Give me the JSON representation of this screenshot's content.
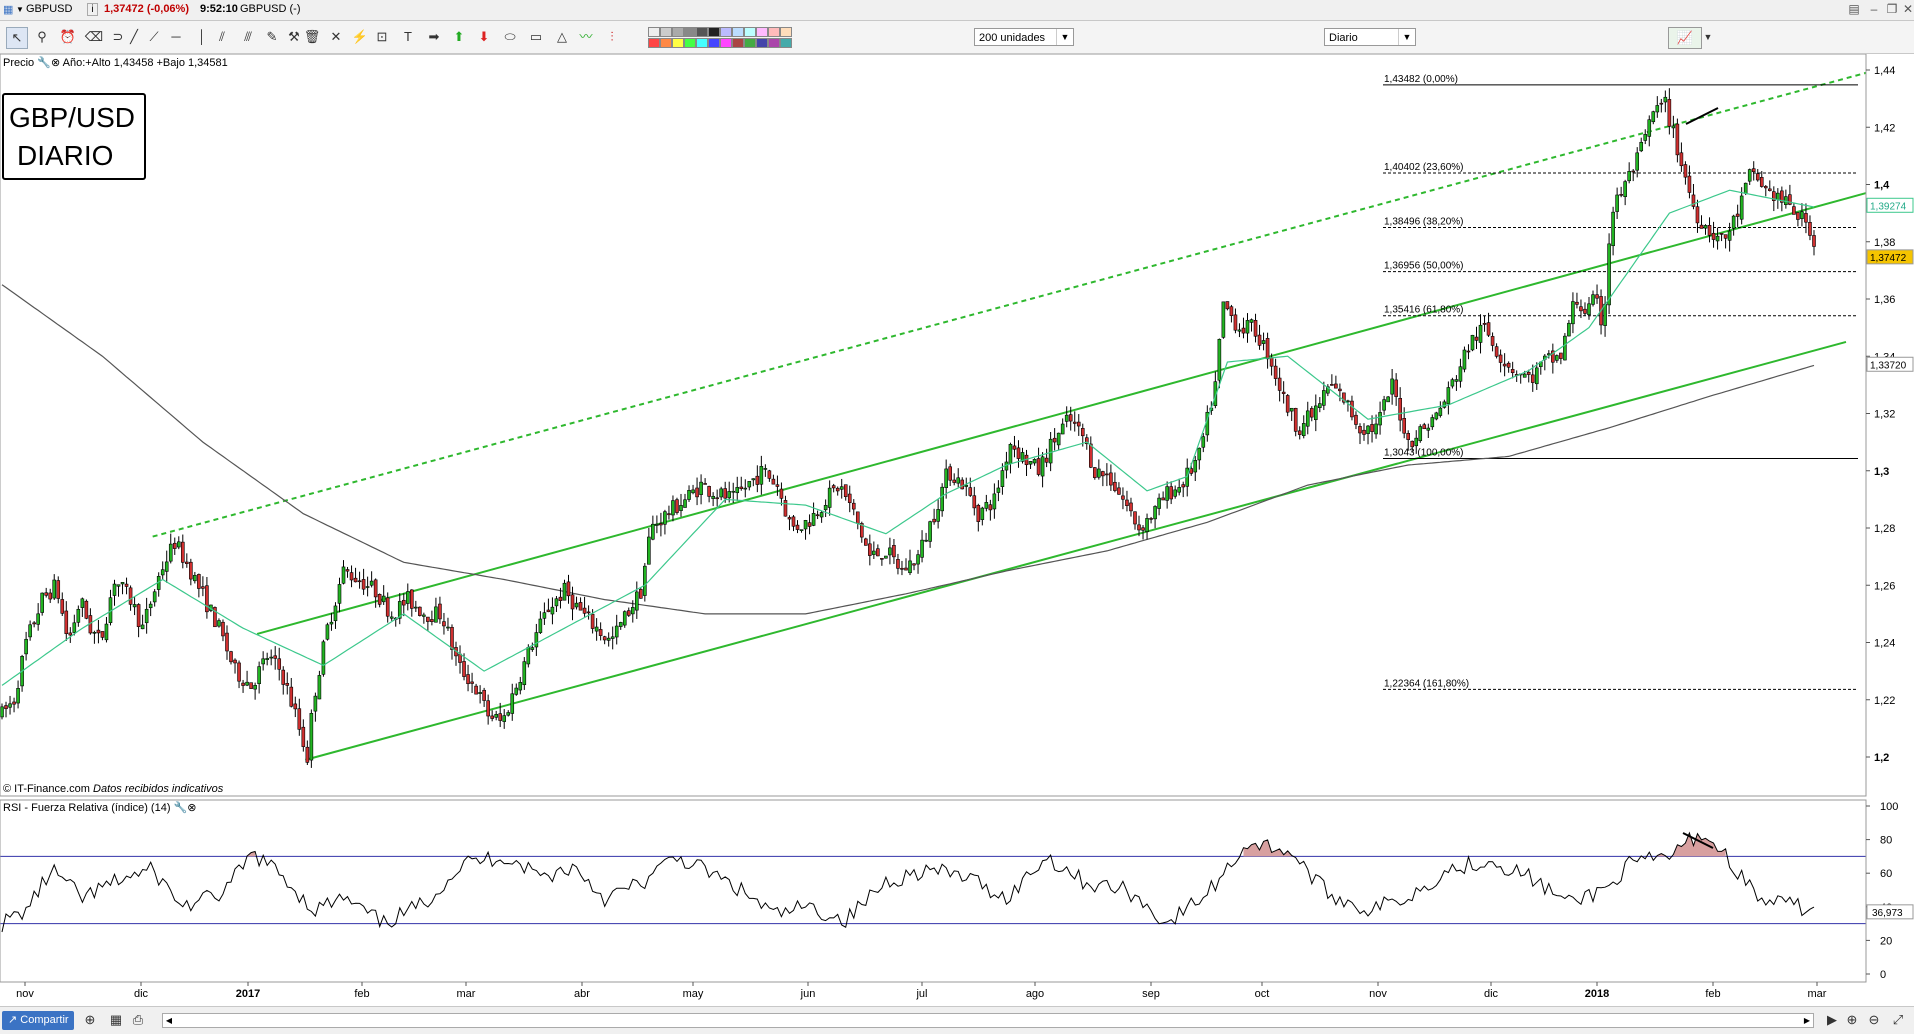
{
  "header": {
    "symbol": "GBPUSD",
    "price_info": "1,37472 (-0,06%)",
    "time_info": "9:52:10",
    "symbol_state": "GBPUSD (-)"
  },
  "toolbar": {
    "units_select": "200 unidades",
    "period_select": "Diario"
  },
  "legend": {
    "price_label": "Precio",
    "year_info": "Año:+Alto 1,43458 +Bajo 1,34581",
    "box_line1": "GBP/USD",
    "box_line2": "DIARIO",
    "source": "© IT-Finance.com",
    "source_note": "Datos recibidos indicativos",
    "rsi_label": "RSI - Fuerza Relativa (índice) (14)"
  },
  "footer": {
    "share_label": "Compartir"
  },
  "colors": {
    "up_candle": "#22b422",
    "down_candle": "#d03030",
    "channel": "#2eb82e",
    "sma_short": "#3cc88c",
    "sma_long": "#555555",
    "rsi_band": "#3333aa",
    "price_tag": "#f5c400"
  },
  "chart_data": [
    {
      "type": "candlestick",
      "title": "GBP/USD DIARIO",
      "x_ticks": [
        "nov",
        "dic",
        "2017",
        "feb",
        "mar",
        "abr",
        "may",
        "jun",
        "jul",
        "ago",
        "sep",
        "oct",
        "nov",
        "dic",
        "2018",
        "feb",
        "mar"
      ],
      "y_ticks": [
        "1,44",
        "1,42",
        "1,4",
        "1,38",
        "1,36",
        "1,34",
        "1,32",
        "1,3",
        "1,28",
        "1,26",
        "1,24",
        "1,22",
        "1,2"
      ],
      "ylim": [
        1.19,
        1.445
      ],
      "anchors": [
        [
          0,
          1.215
        ],
        [
          6,
          1.22
        ],
        [
          12,
          1.24
        ],
        [
          20,
          1.255
        ],
        [
          27,
          1.26
        ],
        [
          33,
          1.24
        ],
        [
          39,
          1.255
        ],
        [
          44,
          1.245
        ],
        [
          49,
          1.24
        ],
        [
          56,
          1.262
        ],
        [
          64,
          1.255
        ],
        [
          70,
          1.245
        ],
        [
          79,
          1.265
        ],
        [
          86,
          1.275
        ],
        [
          94,
          1.265
        ],
        [
          101,
          1.255
        ],
        [
          108,
          1.245
        ],
        [
          116,
          1.23
        ],
        [
          124,
          1.225
        ],
        [
          132,
          1.235
        ],
        [
          139,
          1.23
        ],
        [
          146,
          1.215
        ],
        [
          152,
          1.2
        ],
        [
          155,
          1.22
        ],
        [
          162,
          1.245
        ],
        [
          170,
          1.265
        ],
        [
          178,
          1.262
        ],
        [
          186,
          1.258
        ],
        [
          194,
          1.25
        ],
        [
          202,
          1.255
        ],
        [
          211,
          1.25
        ],
        [
          219,
          1.25
        ],
        [
          227,
          1.232
        ],
        [
          235,
          1.225
        ],
        [
          242,
          1.215
        ],
        [
          249,
          1.212
        ],
        [
          256,
          1.225
        ],
        [
          264,
          1.24
        ],
        [
          272,
          1.252
        ],
        [
          280,
          1.258
        ],
        [
          289,
          1.25
        ],
        [
          296,
          1.245
        ],
        [
          303,
          1.24
        ],
        [
          311,
          1.25
        ],
        [
          318,
          1.258
        ],
        [
          323,
          1.28
        ],
        [
          331,
          1.285
        ],
        [
          340,
          1.29
        ],
        [
          348,
          1.295
        ],
        [
          356,
          1.292
        ],
        [
          364,
          1.29
        ],
        [
          371,
          1.295
        ],
        [
          379,
          1.3
        ],
        [
          386,
          1.295
        ],
        [
          393,
          1.28
        ],
        [
          401,
          1.282
        ],
        [
          410,
          1.29
        ],
        [
          417,
          1.295
        ],
        [
          424,
          1.285
        ],
        [
          432,
          1.27
        ],
        [
          440,
          1.272
        ],
        [
          448,
          1.265
        ],
        [
          456,
          1.27
        ],
        [
          464,
          1.285
        ],
        [
          471,
          1.3
        ],
        [
          479,
          1.295
        ],
        [
          486,
          1.285
        ],
        [
          494,
          1.29
        ],
        [
          502,
          1.31
        ],
        [
          508,
          1.305
        ],
        [
          516,
          1.3
        ],
        [
          523,
          1.31
        ],
        [
          531,
          1.318
        ],
        [
          538,
          1.312
        ],
        [
          544,
          1.3
        ],
        [
          551,
          1.298
        ],
        [
          558,
          1.29
        ],
        [
          566,
          1.28
        ],
        [
          573,
          1.285
        ],
        [
          580,
          1.292
        ],
        [
          587,
          1.295
        ],
        [
          596,
          1.305
        ],
        [
          604,
          1.33
        ],
        [
          608,
          1.358
        ],
        [
          616,
          1.35
        ],
        [
          623,
          1.35
        ],
        [
          631,
          1.34
        ],
        [
          638,
          1.325
        ],
        [
          645,
          1.315
        ],
        [
          653,
          1.32
        ],
        [
          661,
          1.33
        ],
        [
          668,
          1.325
        ],
        [
          676,
          1.315
        ],
        [
          684,
          1.315
        ],
        [
          692,
          1.33
        ],
        [
          700,
          1.31
        ],
        [
          708,
          1.315
        ],
        [
          715,
          1.32
        ],
        [
          723,
          1.332
        ],
        [
          731,
          1.345
        ],
        [
          738,
          1.35
        ],
        [
          746,
          1.34
        ],
        [
          753,
          1.335
        ],
        [
          761,
          1.332
        ],
        [
          768,
          1.338
        ],
        [
          776,
          1.34
        ],
        [
          783,
          1.36
        ],
        [
          789,
          1.355
        ],
        [
          793,
          1.36
        ],
        [
          797,
          1.35
        ],
        [
          801,
          1.39
        ],
        [
          808,
          1.4
        ],
        [
          815,
          1.41
        ],
        [
          822,
          1.425
        ],
        [
          828,
          1.428
        ],
        [
          835,
          1.41
        ],
        [
          843,
          1.39
        ],
        [
          850,
          1.384
        ],
        [
          857,
          1.38
        ],
        [
          864,
          1.39
        ],
        [
          871,
          1.405
        ],
        [
          878,
          1.398
        ],
        [
          885,
          1.395
        ],
        [
          893,
          1.39
        ],
        [
          900,
          1.385
        ],
        [
          903,
          1.375
        ]
      ],
      "sma_short": [
        [
          0,
          1.225
        ],
        [
          40,
          1.245
        ],
        [
          80,
          1.262
        ],
        [
          120,
          1.245
        ],
        [
          160,
          1.232
        ],
        [
          200,
          1.25
        ],
        [
          240,
          1.23
        ],
        [
          280,
          1.245
        ],
        [
          320,
          1.26
        ],
        [
          360,
          1.29
        ],
        [
          400,
          1.288
        ],
        [
          440,
          1.278
        ],
        [
          470,
          1.292
        ],
        [
          500,
          1.302
        ],
        [
          540,
          1.31
        ],
        [
          570,
          1.293
        ],
        [
          590,
          1.298
        ],
        [
          610,
          1.338
        ],
        [
          640,
          1.34
        ],
        [
          680,
          1.318
        ],
        [
          720,
          1.323
        ],
        [
          760,
          1.335
        ],
        [
          790,
          1.35
        ],
        [
          830,
          1.39
        ],
        [
          860,
          1.398
        ],
        [
          903,
          1.392
        ]
      ],
      "sma_long": [
        [
          0,
          1.365
        ],
        [
          50,
          1.34
        ],
        [
          100,
          1.31
        ],
        [
          150,
          1.285
        ],
        [
          200,
          1.268
        ],
        [
          250,
          1.262
        ],
        [
          300,
          1.255
        ],
        [
          350,
          1.25
        ],
        [
          400,
          1.25
        ],
        [
          450,
          1.257
        ],
        [
          500,
          1.265
        ],
        [
          550,
          1.272
        ],
        [
          600,
          1.282
        ],
        [
          650,
          1.295
        ],
        [
          700,
          1.302
        ],
        [
          750,
          1.305
        ],
        [
          800,
          1.315
        ],
        [
          850,
          1.326
        ],
        [
          903,
          1.337
        ]
      ],
      "fib_levels": [
        {
          "label": "1,43482 (0,00%)",
          "value": 1.43482
        },
        {
          "label": "1,40402 (23,60%)",
          "value": 1.40402
        },
        {
          "label": "1,38496 (38,20%)",
          "value": 1.38496
        },
        {
          "label": "1,36956 (50,00%)",
          "value": 1.36956
        },
        {
          "label": "1,35416 (61,80%)",
          "value": 1.35416
        },
        {
          "label": "1,3043 (100,00%)",
          "value": 1.3043
        },
        {
          "label": "1,22364 (161,80%)",
          "value": 1.22364
        }
      ],
      "price_tags": [
        {
          "label": "1,39274",
          "value": 1.39274
        },
        {
          "label": "1,37472",
          "value": 1.37472
        },
        {
          "label": "1,33720",
          "value": 1.3372
        }
      ]
    },
    {
      "type": "line",
      "title": "RSI - Fuerza Relativa (índice) (14)",
      "y_ticks": [
        "100",
        "80",
        "60",
        "40",
        "20",
        "0"
      ],
      "ylim": [
        0,
        100
      ],
      "bands": [
        70,
        30
      ],
      "last_label": "36,973",
      "values_anchors": [
        [
          0,
          30
        ],
        [
          12,
          38
        ],
        [
          25,
          62
        ],
        [
          40,
          45
        ],
        [
          60,
          57
        ],
        [
          75,
          62
        ],
        [
          90,
          40
        ],
        [
          110,
          48
        ],
        [
          125,
          72
        ],
        [
          140,
          58
        ],
        [
          155,
          38
        ],
        [
          170,
          45
        ],
        [
          190,
          30
        ],
        [
          210,
          42
        ],
        [
          230,
          66
        ],
        [
          250,
          70
        ],
        [
          270,
          58
        ],
        [
          285,
          64
        ],
        [
          300,
          45
        ],
        [
          320,
          55
        ],
        [
          335,
          70
        ],
        [
          350,
          62
        ],
        [
          370,
          48
        ],
        [
          385,
          35
        ],
        [
          400,
          40
        ],
        [
          420,
          32
        ],
        [
          440,
          55
        ],
        [
          460,
          62
        ],
        [
          480,
          58
        ],
        [
          500,
          45
        ],
        [
          520,
          70
        ],
        [
          540,
          54
        ],
        [
          560,
          50
        ],
        [
          580,
          30
        ],
        [
          600,
          48
        ],
        [
          620,
          78
        ],
        [
          640,
          74
        ],
        [
          660,
          48
        ],
        [
          680,
          38
        ],
        [
          700,
          46
        ],
        [
          720,
          62
        ],
        [
          740,
          68
        ],
        [
          760,
          58
        ],
        [
          780,
          42
        ],
        [
          800,
          52
        ],
        [
          810,
          65
        ],
        [
          830,
          70
        ],
        [
          845,
          84
        ],
        [
          855,
          75
        ],
        [
          875,
          44
        ],
        [
          895,
          40
        ],
        [
          903,
          37
        ]
      ]
    }
  ]
}
